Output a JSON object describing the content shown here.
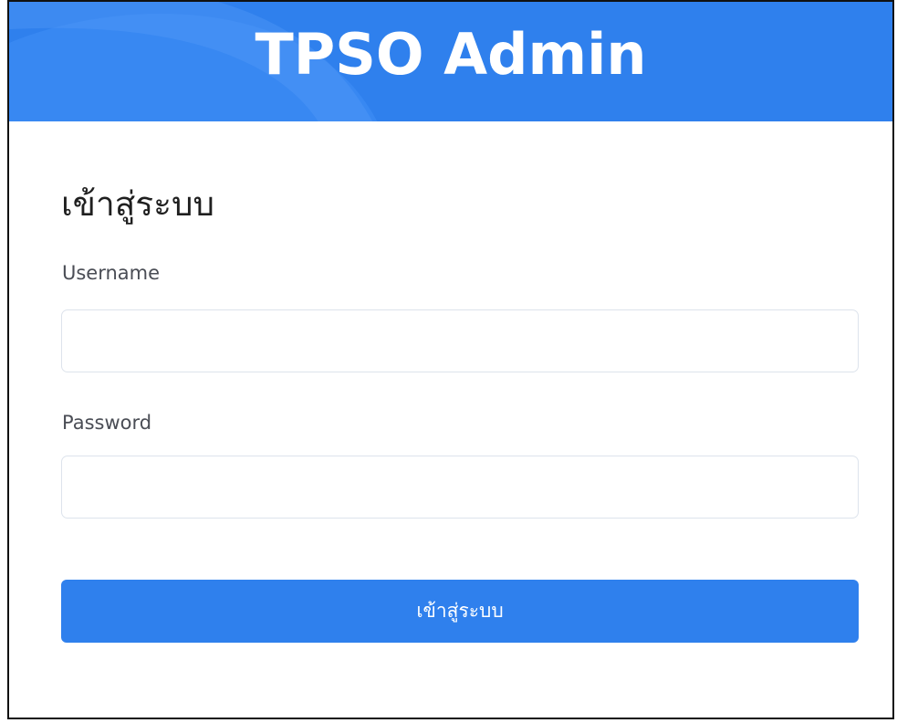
{
  "app": {
    "title": "TPSO Admin",
    "accent_color": "#2f80ed"
  },
  "login": {
    "heading": "เข้าสู่ระบบ",
    "username_label": "Username",
    "username_value": "",
    "password_label": "Password",
    "password_value": "",
    "submit_label": "เข้าสู่ระบบ"
  }
}
